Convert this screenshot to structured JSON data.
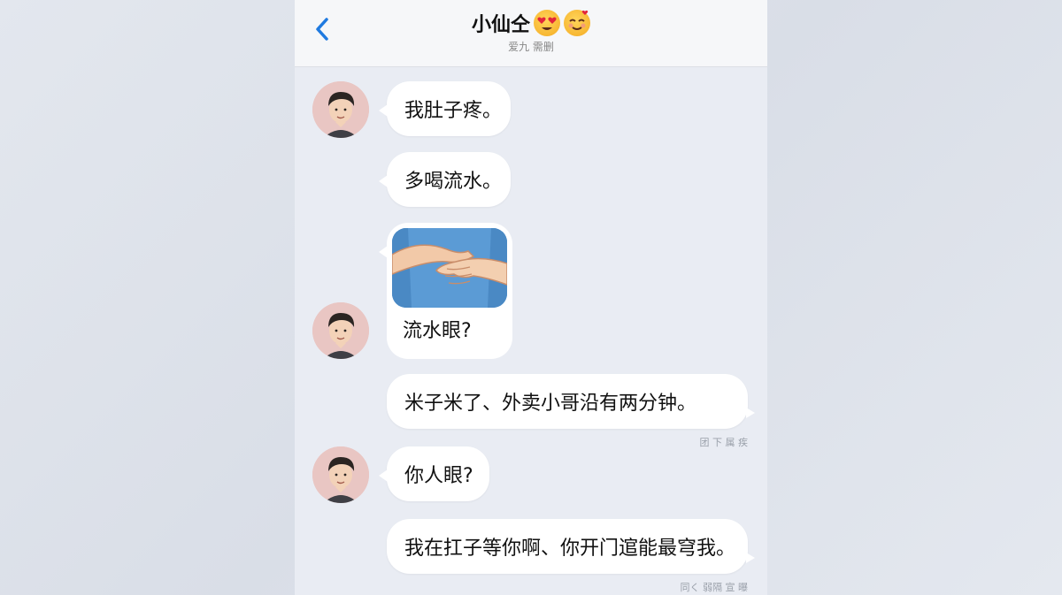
{
  "header": {
    "title": "小仙仝",
    "subtitle": "爱九 需删",
    "emoji_1": "heart-eyes-emoji",
    "emoji_2": "smiling-in-love-emoji"
  },
  "messages": [
    {
      "side": "left",
      "text": "我肚子疼。",
      "avatar": true
    },
    {
      "side": "left",
      "text": "多喝流水。",
      "avatar": false
    },
    {
      "side": "left",
      "type": "image",
      "image": "hands-on-belly-illustration",
      "caption": "流水眼?",
      "avatar": true
    },
    {
      "side": "right",
      "text": "米子米了、外卖小哥沿有两分钟。",
      "status": "团 下 属 疾"
    },
    {
      "side": "left",
      "text": "你人眼?",
      "avatar": true
    },
    {
      "side": "right",
      "text": "我在扛子等你啊、你开门逭能最穹我。",
      "status": "同く 弱隔 宣 曝"
    }
  ],
  "colors": {
    "background": "#e9ecf3",
    "bubble": "#ffffff",
    "accent": "#1f7ae0",
    "avatar_bg": "#e9c6c3"
  }
}
